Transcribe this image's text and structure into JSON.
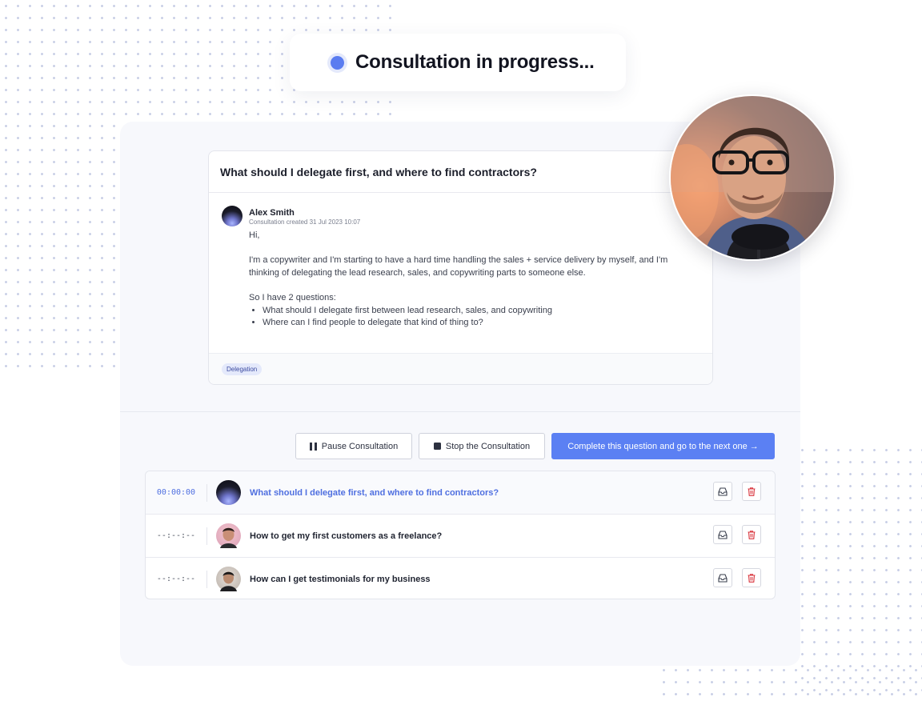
{
  "status": {
    "title": "Consultation in progress..."
  },
  "question_card": {
    "title": "What should I delegate first, and where to find contractors?",
    "author": {
      "name": "Alex Smith",
      "meta": "Consultation created 31 Jul 2023 10:07"
    },
    "message": {
      "greeting": "Hi,",
      "paragraph": "I'm a copywriter and I'm starting to have a hard time handling the sales + service delivery by myself, and I'm thinking of delegating the lead research, sales, and copywriting parts to someone else.",
      "intro": "So I have 2 questions:",
      "bullets": [
        "What should I delegate first between lead research, sales, and copywriting",
        "Where can I find people to delegate that kind of thing to?"
      ]
    },
    "tag": "Delegation"
  },
  "controls": {
    "pause_label": "Pause Consultation",
    "stop_label": "Stop the Consultation",
    "complete_label": "Complete this question and go to the next one →"
  },
  "questions": [
    {
      "timer": "00:00:00",
      "text": "What should I delegate first, and where to find contractors?",
      "active": true
    },
    {
      "timer": "--:--:--",
      "text": "How to get my first customers as a freelance?",
      "active": false
    },
    {
      "timer": "--:--:--",
      "text": "How can I get testimonials for my business",
      "active": false
    }
  ],
  "icons": {
    "status": "status-dot-icon",
    "pause": "pause-icon",
    "stop": "stop-icon",
    "archive": "archive-tray-icon",
    "delete": "trash-icon"
  },
  "colors": {
    "accent": "#5b80f3",
    "status_dot": "#5a7cf0",
    "delete": "#d9363e",
    "tag_bg": "#e4e9fb"
  }
}
